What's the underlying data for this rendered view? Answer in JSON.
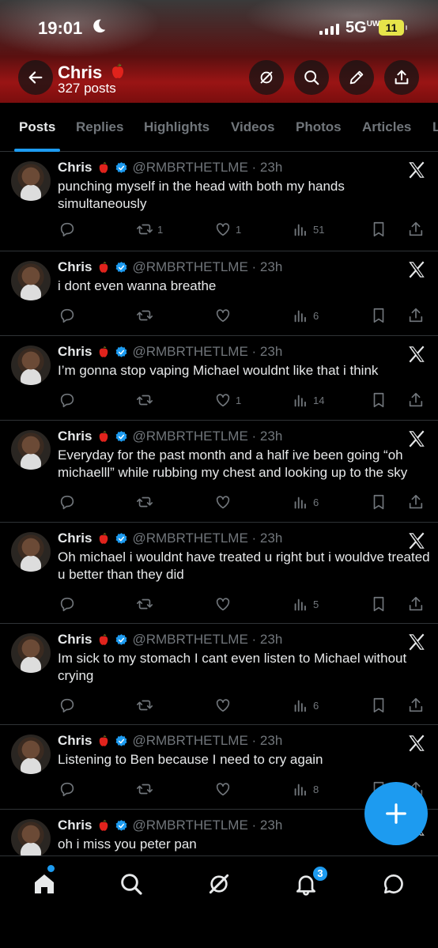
{
  "status_bar": {
    "time": "19:01",
    "network": "5G",
    "network_sup": "UW",
    "battery": "11"
  },
  "header": {
    "name": "Chris",
    "post_count": "327 posts"
  },
  "tabs": [
    "Posts",
    "Replies",
    "Highlights",
    "Videos",
    "Photos",
    "Articles",
    "L"
  ],
  "tweets": [
    {
      "name": "Chris",
      "handle": "@RMBRTHETLME · 23h",
      "text": "punching myself in the head with both my hands simultaneously",
      "reposts": "1",
      "likes": "1",
      "views": "51"
    },
    {
      "name": "Chris",
      "handle": "@RMBRTHETLME · 23h",
      "text": "i dont even wanna breathe",
      "reposts": "",
      "likes": "",
      "views": "6"
    },
    {
      "name": "Chris",
      "handle": "@RMBRTHETLME · 23h",
      "text": "I’m gonna stop vaping Michael wouldnt like that i think",
      "reposts": "",
      "likes": "1",
      "views": "14"
    },
    {
      "name": "Chris",
      "handle": "@RMBRTHETLME · 23h",
      "text": "Everyday for the past month and a half ive been going “oh michaelll” while rubbing my chest and looking up to the sky",
      "reposts": "",
      "likes": "",
      "views": "6"
    },
    {
      "name": "Chris",
      "handle": "@RMBRTHETLME · 23h",
      "text": "Oh michael i wouldnt have treated u right but i wouldve treated u better than they did",
      "reposts": "",
      "likes": "",
      "views": "5"
    },
    {
      "name": "Chris",
      "handle": "@RMBRTHETLME · 23h",
      "text": "Im sick to my stomach I cant even listen to Michael without crying",
      "reposts": "",
      "likes": "",
      "views": "6"
    },
    {
      "name": "Chris",
      "handle": "@RMBRTHETLME · 23h",
      "text": "Listening to Ben because I need to cry again",
      "reposts": "",
      "likes": "",
      "views": "8"
    },
    {
      "name": "Chris",
      "handle": "@RMBRTHETLME · 23h",
      "text": "oh i miss you peter pan",
      "reposts": "",
      "likes": "",
      "views": ""
    }
  ],
  "bottom_nav": {
    "notifications_badge": "3"
  },
  "icons": [
    "back-arrow-icon",
    "grok-icon",
    "search-icon",
    "edit-icon",
    "share-icon",
    "x-logo-icon",
    "reply-icon",
    "repost-icon",
    "like-icon",
    "views-icon",
    "bookmark-icon",
    "plus-icon",
    "home-icon",
    "bell-icon",
    "messages-icon"
  ],
  "colors": {
    "accent": "#1d9bf0",
    "background": "#000000",
    "text": "#e7e9ea",
    "secondary_text": "#71767b",
    "banner": "#9a1414"
  }
}
